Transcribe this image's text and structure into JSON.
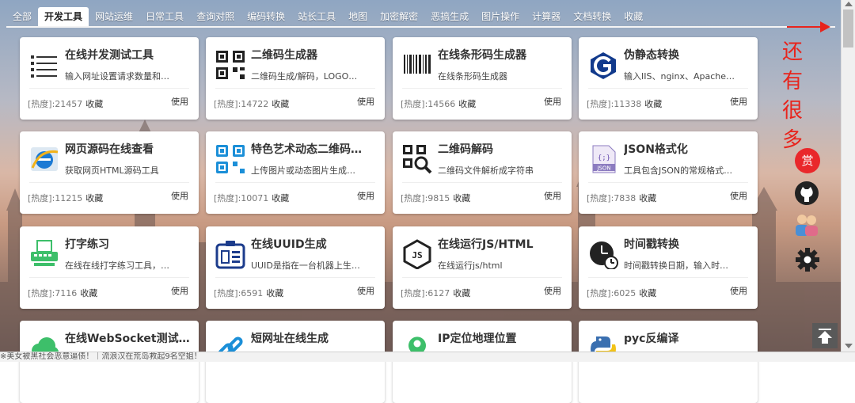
{
  "tabs": [
    "全部",
    "开发工具",
    "网站运维",
    "日常工具",
    "查询对照",
    "编码转换",
    "站长工具",
    "地图",
    "加密解密",
    "恶搞生成",
    "图片操作",
    "计算器",
    "文档转换",
    "收藏"
  ],
  "active_tab": 1,
  "stats_prefix": "[热度]:",
  "fav_label": "收藏",
  "use_label": "使用",
  "cards": [
    {
      "title": "在线并发测试工具",
      "desc": "输入网址设置请求数量和…",
      "heat": "21457",
      "icon": "list-icon"
    },
    {
      "title": "二维码生成器",
      "desc": "二维码生成/解码，LOGO…",
      "heat": "14722",
      "icon": "qr-code-icon"
    },
    {
      "title": "在线条形码生成器",
      "desc": "在线条形码生成器",
      "heat": "14566",
      "icon": "barcode-icon"
    },
    {
      "title": "伪静态转换",
      "desc": "输入IIS、nginx、Apache…",
      "heat": "11338",
      "icon": "g-logo-icon"
    },
    {
      "title": "网页源码在线查看",
      "desc": "获取网页HTML源码工具",
      "heat": "11215",
      "icon": "ie-browser-icon"
    },
    {
      "title": "特色艺术动态二维码…",
      "desc": "上传图片或动态图片生成…",
      "heat": "10071",
      "icon": "art-qr-icon"
    },
    {
      "title": "二维码解码",
      "desc": "二维码文件解析成字符串",
      "heat": "9815",
      "icon": "qr-search-icon"
    },
    {
      "title": "JSON格式化",
      "desc": "工具包含JSON的常规格式…",
      "heat": "7838",
      "icon": "json-file-icon"
    },
    {
      "title": "打字练习",
      "desc": "在线在线打字练习工具，…",
      "heat": "7116",
      "icon": "typewriter-icon"
    },
    {
      "title": "在线UUID生成",
      "desc": "UUID是指在一台机器上生…",
      "heat": "6591",
      "icon": "id-badge-icon"
    },
    {
      "title": "在线运行JS/HTML",
      "desc": "在线运行js/html",
      "heat": "6127",
      "icon": "js-icon"
    },
    {
      "title": "时间戳转换",
      "desc": "时间戳转换日期，输入时…",
      "heat": "6025",
      "icon": "clock-icon"
    },
    {
      "title": "在线WebSocket测试…",
      "desc": "",
      "heat": "",
      "icon": "cloud-icon"
    },
    {
      "title": "短网址在线生成",
      "desc": "",
      "heat": "",
      "icon": "link-icon"
    },
    {
      "title": "IP定位地理位置",
      "desc": "",
      "heat": "",
      "icon": "map-pin-icon"
    },
    {
      "title": "pyc反编译",
      "desc": "",
      "heat": "",
      "icon": "python-icon"
    }
  ],
  "side_text": [
    "还",
    "有",
    "很",
    "多"
  ],
  "reward_label": "赏",
  "status_text": "※美女被黑社会恶意逼债！｜流浪汉在荒岛救起9名空姐！",
  "colors": {
    "accent_red": "#e8241c",
    "card_bg": "#ffffff",
    "icon_dark": "#222222",
    "icon_blue": "#1b8fd8",
    "icon_green": "#3dbf6a"
  }
}
